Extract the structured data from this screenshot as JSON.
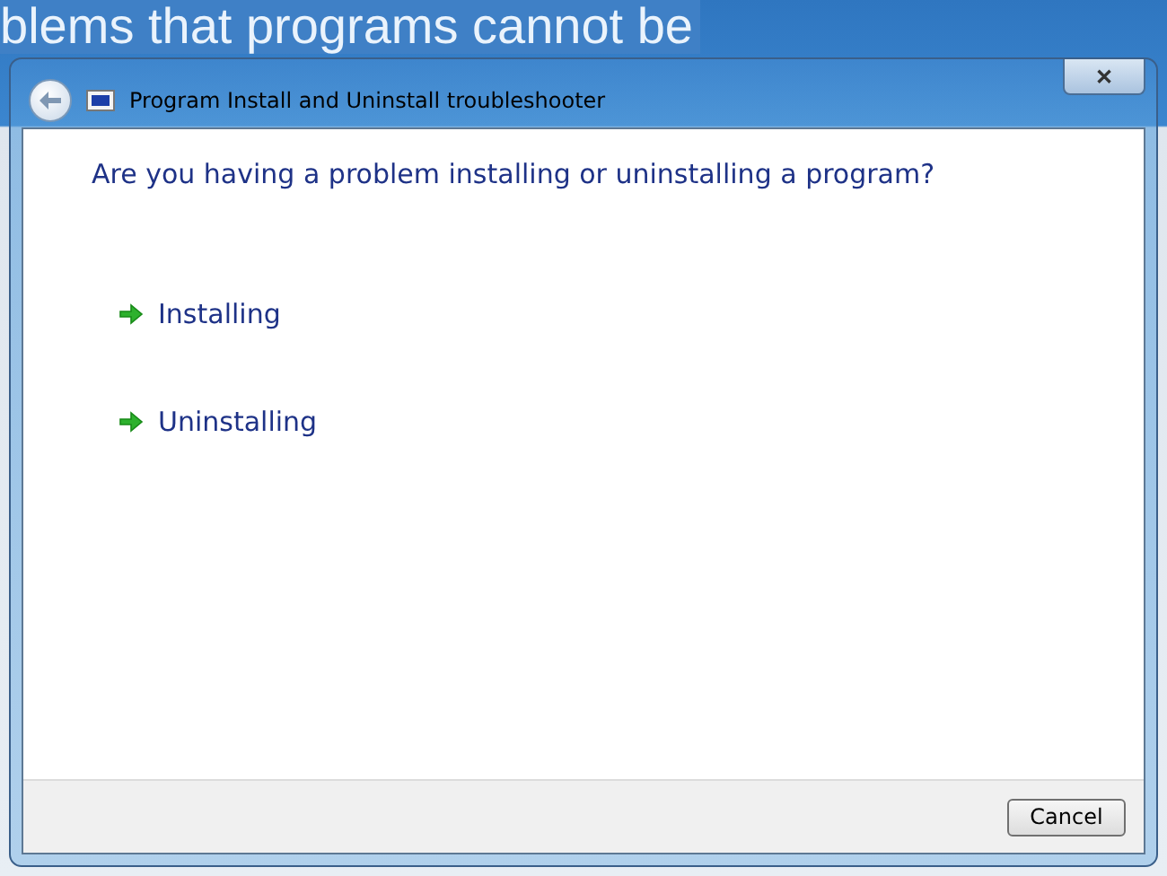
{
  "background_page": {
    "heading": "blems that programs cannot be"
  },
  "window": {
    "title": "Program Install and Uninstall troubleshooter",
    "close": "✕"
  },
  "question": "Are you having a problem installing or uninstalling a program?",
  "options": [
    {
      "label": "Installing"
    },
    {
      "label": "Uninstalling"
    }
  ],
  "buttons": [
    "Cancel"
  ]
}
